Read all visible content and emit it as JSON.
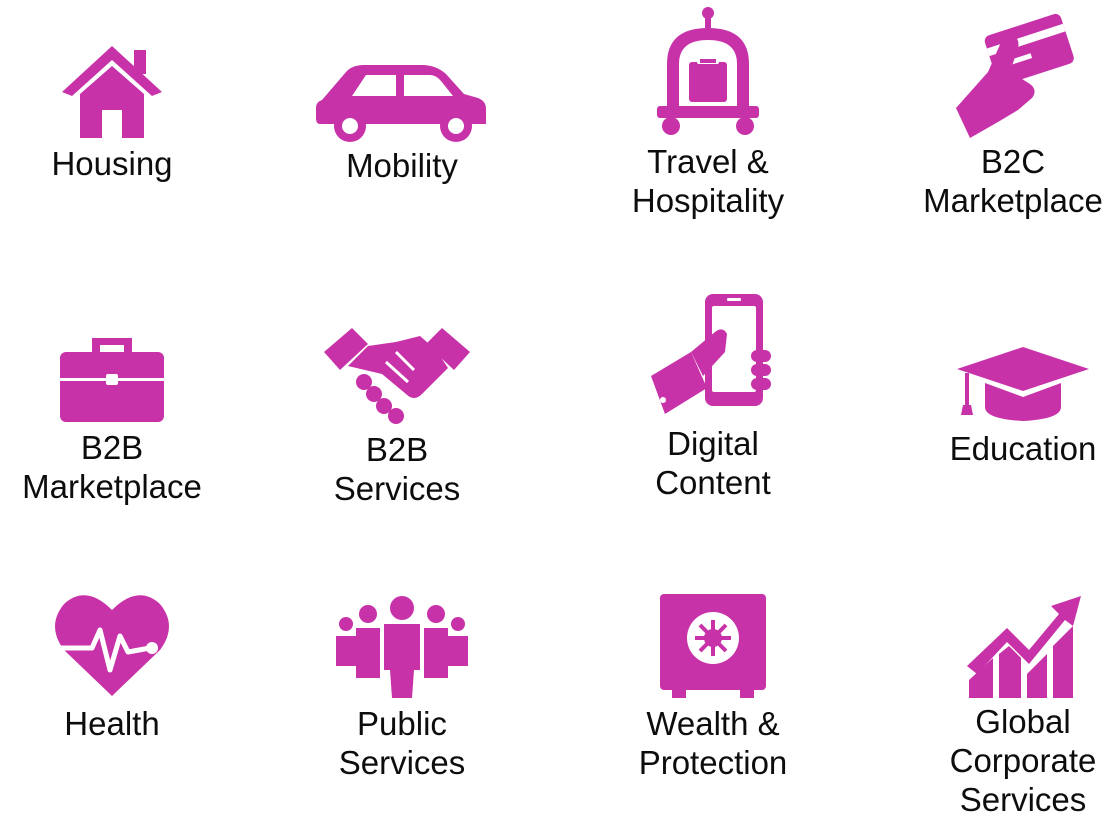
{
  "colors": {
    "accent": "#c832a8",
    "text": "#0d0d0d",
    "background": "#ffffff"
  },
  "tiles": [
    {
      "icon": "house-icon",
      "label": "Housing"
    },
    {
      "icon": "car-icon",
      "label": "Mobility"
    },
    {
      "icon": "luggage-cart-icon",
      "label": "Travel &\nHospitality"
    },
    {
      "icon": "hand-card-icon",
      "label": "B2C\nMarketplace"
    },
    {
      "icon": "briefcase-icon",
      "label": "B2B\nMarketplace"
    },
    {
      "icon": "handshake-icon",
      "label": "B2B\nServices"
    },
    {
      "icon": "hand-phone-icon",
      "label": "Digital\nContent"
    },
    {
      "icon": "graduation-cap-icon",
      "label": "Education"
    },
    {
      "icon": "heart-pulse-icon",
      "label": "Health"
    },
    {
      "icon": "people-group-icon",
      "label": "Public\nServices"
    },
    {
      "icon": "safe-icon",
      "label": "Wealth &\nProtection"
    },
    {
      "icon": "growth-chart-icon",
      "label": "Global\nCorporate\nServices"
    }
  ]
}
